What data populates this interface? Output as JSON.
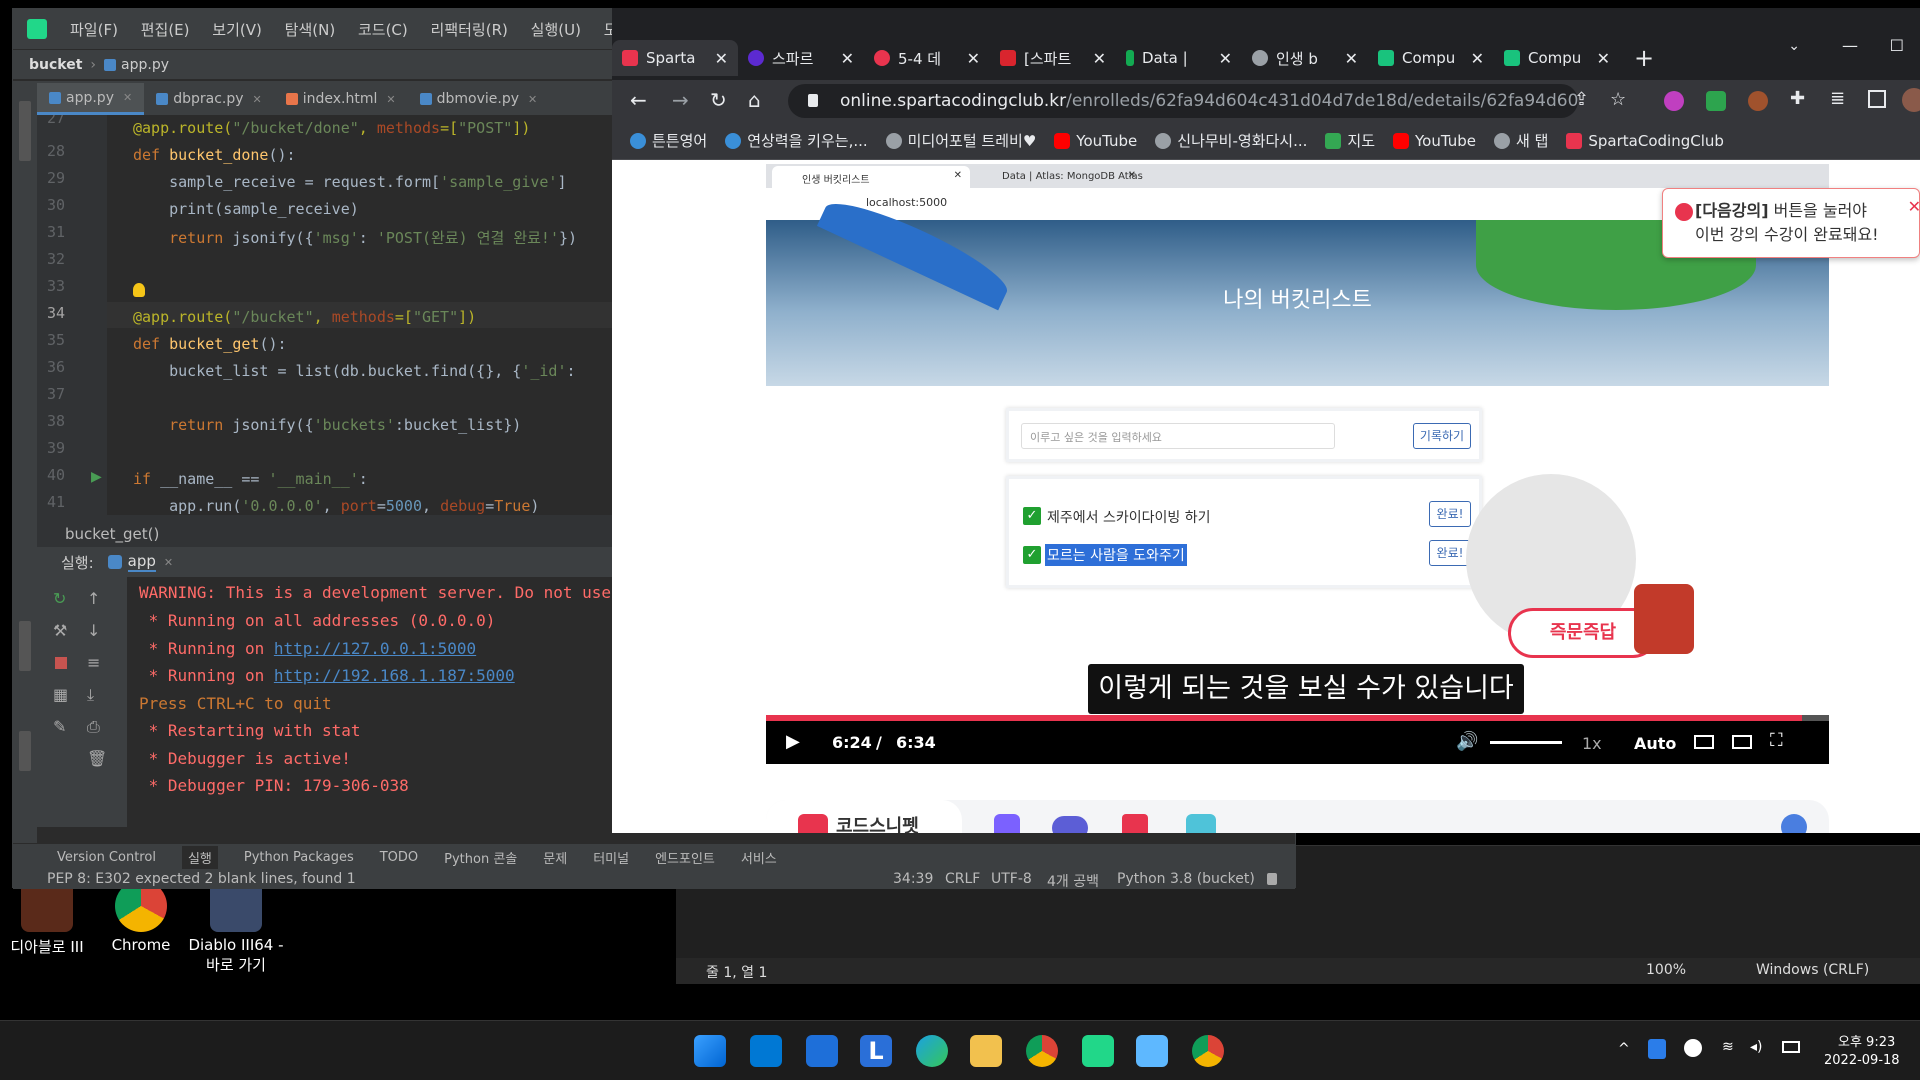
{
  "desktop": {
    "icons": [
      {
        "label": "디아블로 III"
      },
      {
        "label": "Chrome"
      },
      {
        "label": "Diablo III64 - 바로 가기"
      }
    ]
  },
  "notepad": {
    "position": "줄 1, 열 1",
    "zoom": "100%",
    "encoding": "Windows (CRLF)"
  },
  "pycharm": {
    "menu": [
      "파일(F)",
      "편집(E)",
      "보기(V)",
      "탐색(N)",
      "코드(C)",
      "리팩터링(R)",
      "실행(U)",
      "도구(T)"
    ],
    "project": "bucket",
    "current_file": "app.py",
    "tabs": [
      "app.py",
      "dbprac.py",
      "index.html",
      "dbmovie.py"
    ],
    "line_numbers": [
      "27",
      "28",
      "29",
      "30",
      "31",
      "32",
      "33",
      "34",
      "35",
      "36",
      "37",
      "38",
      "39",
      "40",
      "41"
    ],
    "breadcrumb": "bucket_get()",
    "run_label": "실행:",
    "run_config": "app",
    "console": [
      "WARNING: This is a development server. Do not use",
      " * Running on all addresses (0.0.0.0)",
      " * Running on ",
      " * Running on ",
      "Press CTRL+C to quit",
      " * Restarting with stat",
      " * Debugger is active!",
      " * Debugger PIN: 179-306-038"
    ],
    "console_links": [
      "http://127.0.0.1:5000",
      "http://192.168.1.187:5000"
    ],
    "toolwindows": [
      "Version Control",
      "실행",
      "Python Packages",
      "TODO",
      "Python 콘솔",
      "문제",
      "터미널",
      "엔드포인트",
      "서비스"
    ],
    "status_left": "PEP 8: E302 expected 2 blank lines, found 1",
    "status_right": [
      "34:39",
      "CRLF",
      "UTF-8",
      "4개 공백",
      "Python 3.8 (bucket)"
    ]
  },
  "chrome": {
    "tabs": [
      "Sparta",
      "스파르",
      "5-4 데",
      "[스파트",
      "Data |",
      "인생 b",
      "Compu",
      "Compu"
    ],
    "url_host": "online.spartacodingclub.kr",
    "url_path": "/enrolleds/62fa94d604c431d04d7de18d/edetails/62fa94d604c43...",
    "bookmarks": [
      "튼튼영어",
      "연상력을 키우는,...",
      "미디어포털 트레비♥",
      "YouTube",
      "신나무비-영화다시...",
      "지도",
      "YouTube",
      "새 탭",
      "SpartaCodingClub"
    ],
    "notification": {
      "bold": "[다음강의]",
      "line1": " 버튼을 눌러야",
      "line2": "이번 강의 수강이 완료돼요!"
    },
    "video": {
      "inner_tabs": [
        "인생 버킷리스트",
        "Data | Atlas: MongoDB Atlas"
      ],
      "inner_url": "localhost:5000",
      "hero_title": "나의 버킷리스트",
      "input_placeholder": "이루고 싶은 것을 입력하세요",
      "record_button": "기록하기",
      "items": [
        "제주에서 스카이다이빙 하기",
        "모르는 사람을 도와주기"
      ],
      "done_button": "완료!",
      "caption": "이렇게 되는 것을 보실 수가 있습니다",
      "time_current": "6:24",
      "time_sep": "/",
      "time_total": "6:34",
      "progress": 0.975,
      "speed": "1x",
      "quality": "Auto",
      "badge": "즉문즉답",
      "below_text": "코드스니펫"
    }
  },
  "taskbar": {
    "time": "오후 9:23",
    "date": "2022-09-18"
  }
}
